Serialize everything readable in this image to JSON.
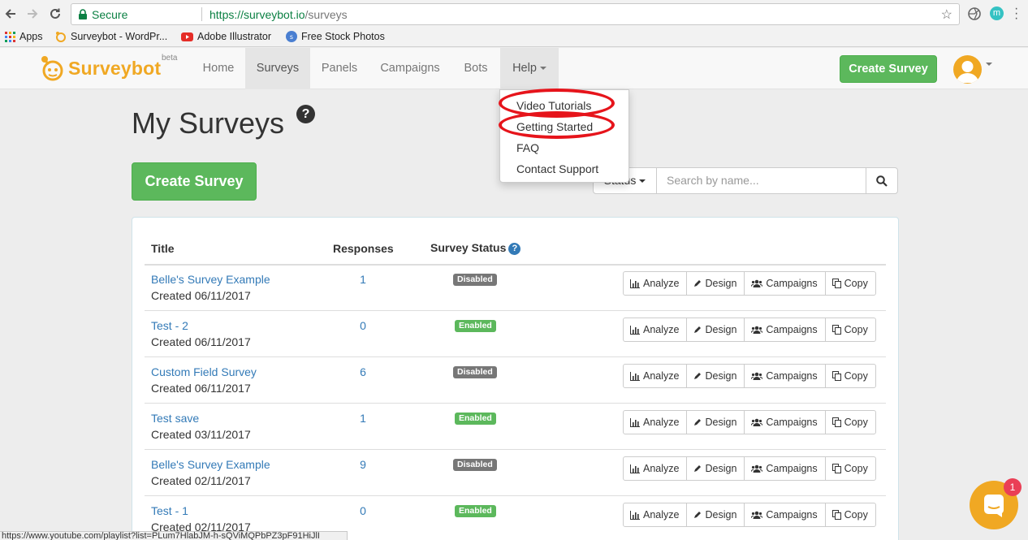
{
  "browser": {
    "secure_label": "Secure",
    "url_host": "https://surveybot.io",
    "url_path": "/surveys",
    "ext_badge": "m"
  },
  "bookmarks": [
    {
      "label": "Apps"
    },
    {
      "label": "Surveybot - WordPr..."
    },
    {
      "label": "Adobe Illustrator"
    },
    {
      "label": "Free Stock Photos"
    }
  ],
  "navbar": {
    "brand": "Surveybot",
    "beta": "beta",
    "items": [
      {
        "label": "Home"
      },
      {
        "label": "Surveys"
      },
      {
        "label": "Panels"
      },
      {
        "label": "Campaigns"
      },
      {
        "label": "Bots"
      },
      {
        "label": "Help"
      }
    ],
    "create_button": "Create Survey"
  },
  "help_menu": {
    "items": [
      {
        "label": "Video Tutorials"
      },
      {
        "label": "Getting Started"
      },
      {
        "label": "FAQ"
      },
      {
        "label": "Contact Support"
      }
    ]
  },
  "main": {
    "title": "My Surveys",
    "help_glyph": "?",
    "create_button": "Create Survey",
    "status_filter": "Status",
    "search_placeholder": "Search by name...",
    "columns": {
      "title": "Title",
      "responses": "Responses",
      "status": "Survey Status",
      "status_help": "?"
    },
    "actions": {
      "analyze": "Analyze",
      "design": "Design",
      "campaigns": "Campaigns",
      "copy": "Copy"
    },
    "surveys": [
      {
        "title": "Belle's Survey Example",
        "created": "Created 06/11/2017",
        "responses": "1",
        "status": "Disabled"
      },
      {
        "title": "Test - 2",
        "created": "Created 06/11/2017",
        "responses": "0",
        "status": "Enabled"
      },
      {
        "title": "Custom Field Survey",
        "created": "Created 06/11/2017",
        "responses": "6",
        "status": "Disabled"
      },
      {
        "title": "Test save",
        "created": "Created 03/11/2017",
        "responses": "1",
        "status": "Enabled"
      },
      {
        "title": "Belle's Survey Example",
        "created": "Created 02/11/2017",
        "responses": "9",
        "status": "Disabled"
      },
      {
        "title": "Test - 1",
        "created": "Created 02/11/2017",
        "responses": "0",
        "status": "Enabled"
      }
    ]
  },
  "status_bar": {
    "url": "https://www.youtube.com/playlist?list=PLum7HlabJM-h-sQViMQPbPZ3pF91HiJlI"
  },
  "chat": {
    "unread": "1"
  },
  "colors": {
    "brand": "#f0a823",
    "success": "#5cb85c",
    "link": "#337ab7",
    "disabled_badge": "#777777",
    "highlight_ring": "#e6141b"
  }
}
